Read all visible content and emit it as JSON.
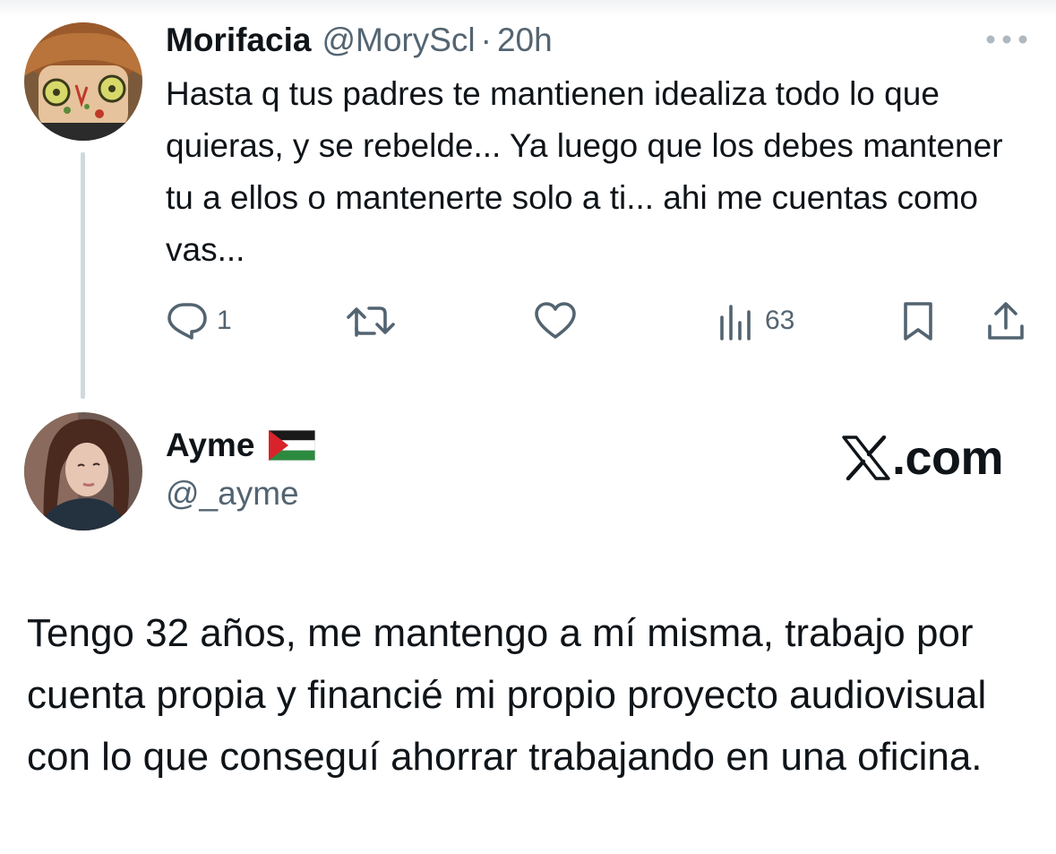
{
  "tweet_parent": {
    "author_name": "Morifacia",
    "handle": "@MoryScl",
    "separator": "·",
    "time": "20h",
    "text": "Hasta q tus padres te mantienen idealiza todo lo que quieras, y se rebelde... Ya luego que los debes mantener tu a ellos o mantenerte solo a ti... ahi me cuentas como vas...",
    "actions": {
      "reply_count": "1",
      "retweet_count": "",
      "like_count": "",
      "views_count": "63"
    },
    "icons": [
      "more-icon",
      "reply-icon",
      "retweet-icon",
      "like-icon",
      "views-icon",
      "bookmark-icon",
      "share-icon"
    ]
  },
  "tweet_reply": {
    "author_name": "Ayme",
    "handle": "@_ayme",
    "flag_icon": "palestine-flag-icon",
    "watermark": "X.com",
    "text": "Tengo 32 años, me mantengo a mí misma, trabajo por cuenta propia y financié mi propio proyecto audiovisual con lo que conseguí ahorrar trabajando en una oficina."
  },
  "colors": {
    "text_primary": "#0f1419",
    "text_secondary": "#536471",
    "thread_line": "#cfd9de"
  }
}
